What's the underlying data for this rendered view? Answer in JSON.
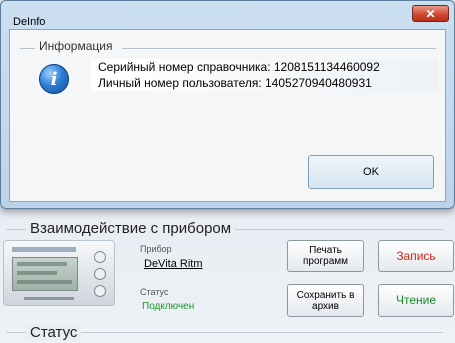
{
  "main_window": {
    "interaction_group_title": "Взаимодействие с прибором",
    "device_label": "Прибор",
    "device_name": "DeVita Ritm",
    "status_label": "Статус",
    "status_value": "Подключен",
    "print_button": "Печать программ",
    "save_button": "Сохранить в архив",
    "record_button": "Запись",
    "read_button": "Чтение",
    "status_group_title": "Статус"
  },
  "dialog": {
    "title": "DeInfo",
    "close_symbol": "✕",
    "group_title": "Информация",
    "icon": "info-icon",
    "message_line1": "Серийный номер справочника: 1208151134460092",
    "message_line2": "Личный номер пользователя: 1405270940480931",
    "ok_button": "OK"
  },
  "colors": {
    "record_text": "#d0281a",
    "read_text": "#1a8a2a",
    "status_connected": "#1a9a2a",
    "close_button": "#cf4a32"
  }
}
